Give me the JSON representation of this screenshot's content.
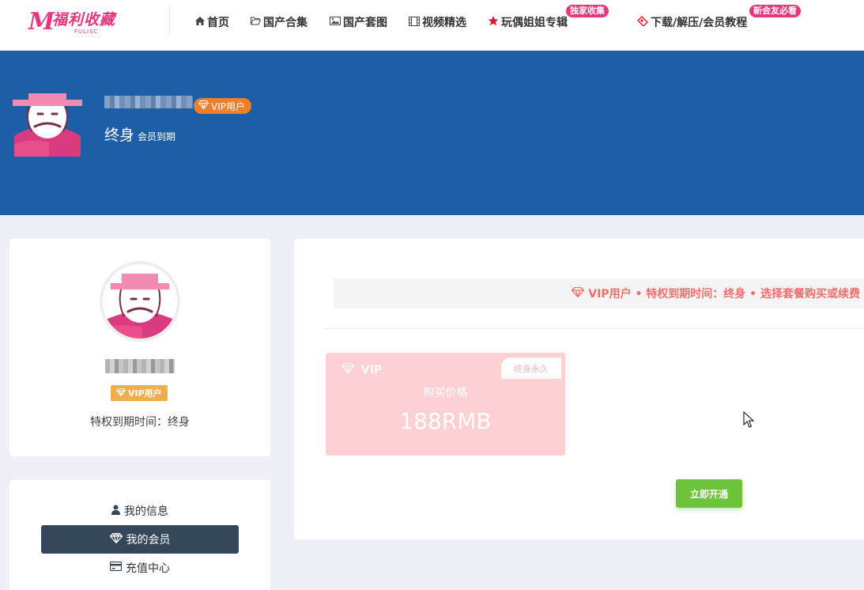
{
  "header": {
    "logo": {
      "mark": "M",
      "title_cn": "福利收藏",
      "title_en": "FULISC"
    },
    "nav": [
      {
        "label": "首页",
        "icon": "home-icon"
      },
      {
        "label": "国产合集",
        "icon": "folder-open-icon"
      },
      {
        "label": "国产套图",
        "icon": "image-icon"
      },
      {
        "label": "视频精选",
        "icon": "film-icon"
      },
      {
        "label": "玩偶姐姐专辑",
        "icon": "star-icon",
        "badge": "独家收集"
      },
      {
        "label": "下载/解压/会员教程",
        "icon": "hand-icon",
        "badge": "新会友必看"
      }
    ]
  },
  "banner": {
    "vip_badge": "VIP用户",
    "expire_value": "终身",
    "expire_label": "会员到期"
  },
  "profile": {
    "vip_tag": "VIP用户",
    "expire_text": "特权到期时间：终身"
  },
  "menu": [
    {
      "label": "我的信息",
      "icon": "user-icon",
      "active": false
    },
    {
      "label": "我的会员",
      "icon": "diamond-icon",
      "active": true
    },
    {
      "label": "充值中心",
      "icon": "credit-card-icon",
      "active": false
    }
  ],
  "main": {
    "notice": "VIP用户 • 特权到期时间：终身 • 选择套餐购买或续费",
    "plan": {
      "name": "VIP",
      "ribbon": "终身永久",
      "price_label": "购买价格",
      "price": "188RMB"
    },
    "buy_button": "立即开通"
  },
  "colors": {
    "brand_pink": "#e8367a",
    "banner_blue": "#1d5fa6",
    "vip_orange": "#f07e2a",
    "menu_active": "#34465a",
    "notice_red": "#f06e6e",
    "plan_bg": "#fdd0d3",
    "buy_green": "#6ec33a"
  }
}
